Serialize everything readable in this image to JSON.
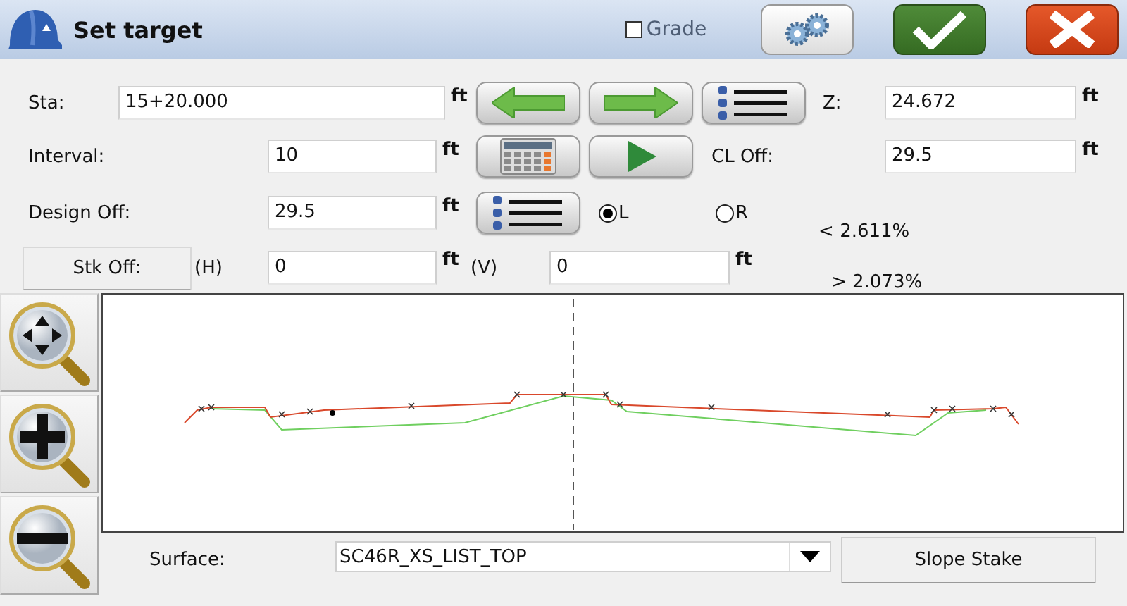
{
  "window": {
    "title": "Set target"
  },
  "grade": {
    "label": "Grade",
    "checked": false
  },
  "station": {
    "label": "Sta:",
    "value": "15+20.000",
    "unit": "ft"
  },
  "z": {
    "label": "Z:",
    "value": "24.672",
    "unit": "ft"
  },
  "interval": {
    "label": "Interval:",
    "value": "10",
    "unit": "ft"
  },
  "cl_offset": {
    "label": "CL Off:",
    "value": "29.5",
    "unit": "ft"
  },
  "design_offset": {
    "label": "Design Off:",
    "value": "29.5",
    "unit": "ft"
  },
  "side": [
    {
      "label": "L",
      "selected": true
    },
    {
      "label": "R",
      "selected": false
    }
  ],
  "slopes": [
    "< 2.611%",
    "> 2.073%"
  ],
  "stake_offset": {
    "button": "Stk Off:",
    "h_label": "(H)",
    "h_value": "0",
    "h_unit": "ft",
    "v_label": "(V)",
    "v_value": "0",
    "v_unit": "ft"
  },
  "surface": {
    "label": "Surface:",
    "value": "SC46R_XS_LIST_TOP"
  },
  "slope_stake_button": "Slope Stake"
}
